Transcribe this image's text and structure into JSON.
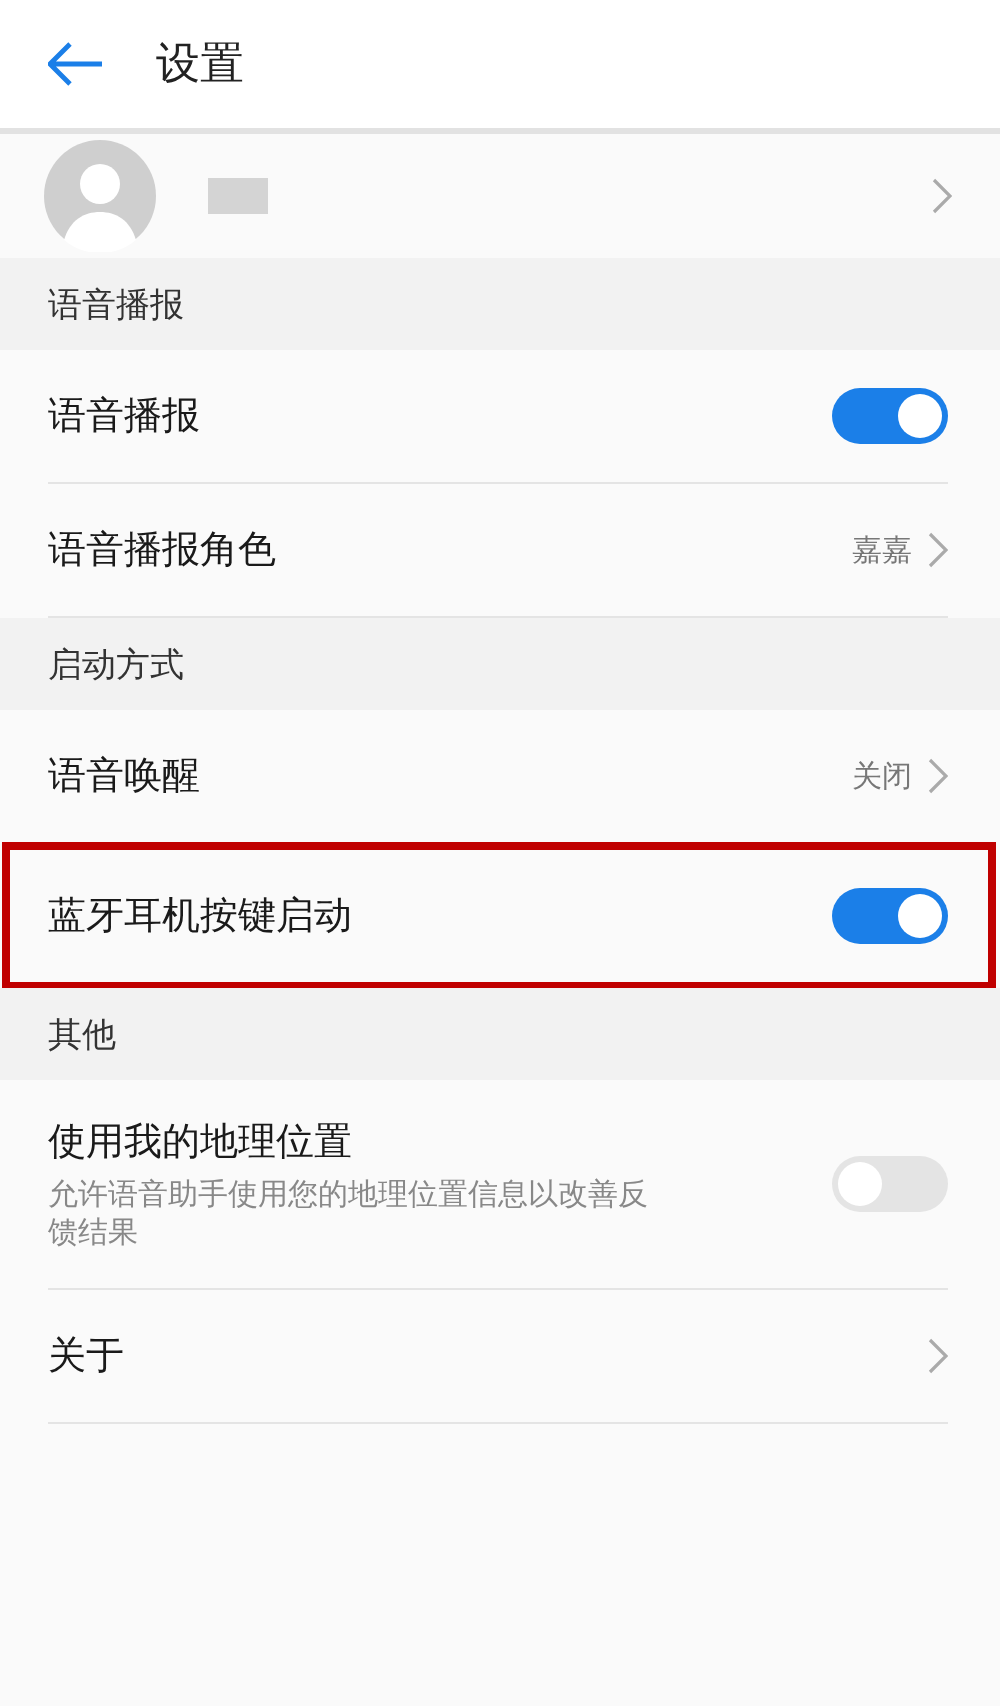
{
  "header": {
    "title": "设置"
  },
  "profile": {
    "redacted": true
  },
  "sections": [
    {
      "title": "语音播报",
      "items": [
        {
          "kind": "toggle",
          "label": "语音播报",
          "on": true,
          "highlighted": false
        },
        {
          "kind": "value",
          "label": "语音播报角色",
          "value": "嘉嘉",
          "highlighted": false
        }
      ]
    },
    {
      "title": "启动方式",
      "items": [
        {
          "kind": "value",
          "label": "语音唤醒",
          "value": "关闭",
          "highlighted": false
        },
        {
          "kind": "toggle",
          "label": "蓝牙耳机按键启动",
          "on": true,
          "highlighted": true
        }
      ]
    },
    {
      "title": "其他",
      "items": [
        {
          "kind": "toggle",
          "label": "使用我的地理位置",
          "description": "允许语音助手使用您的地理位置信息以改善反馈结果",
          "on": false,
          "highlighted": false
        },
        {
          "kind": "link",
          "label": "关于",
          "highlighted": false
        }
      ]
    }
  ]
}
